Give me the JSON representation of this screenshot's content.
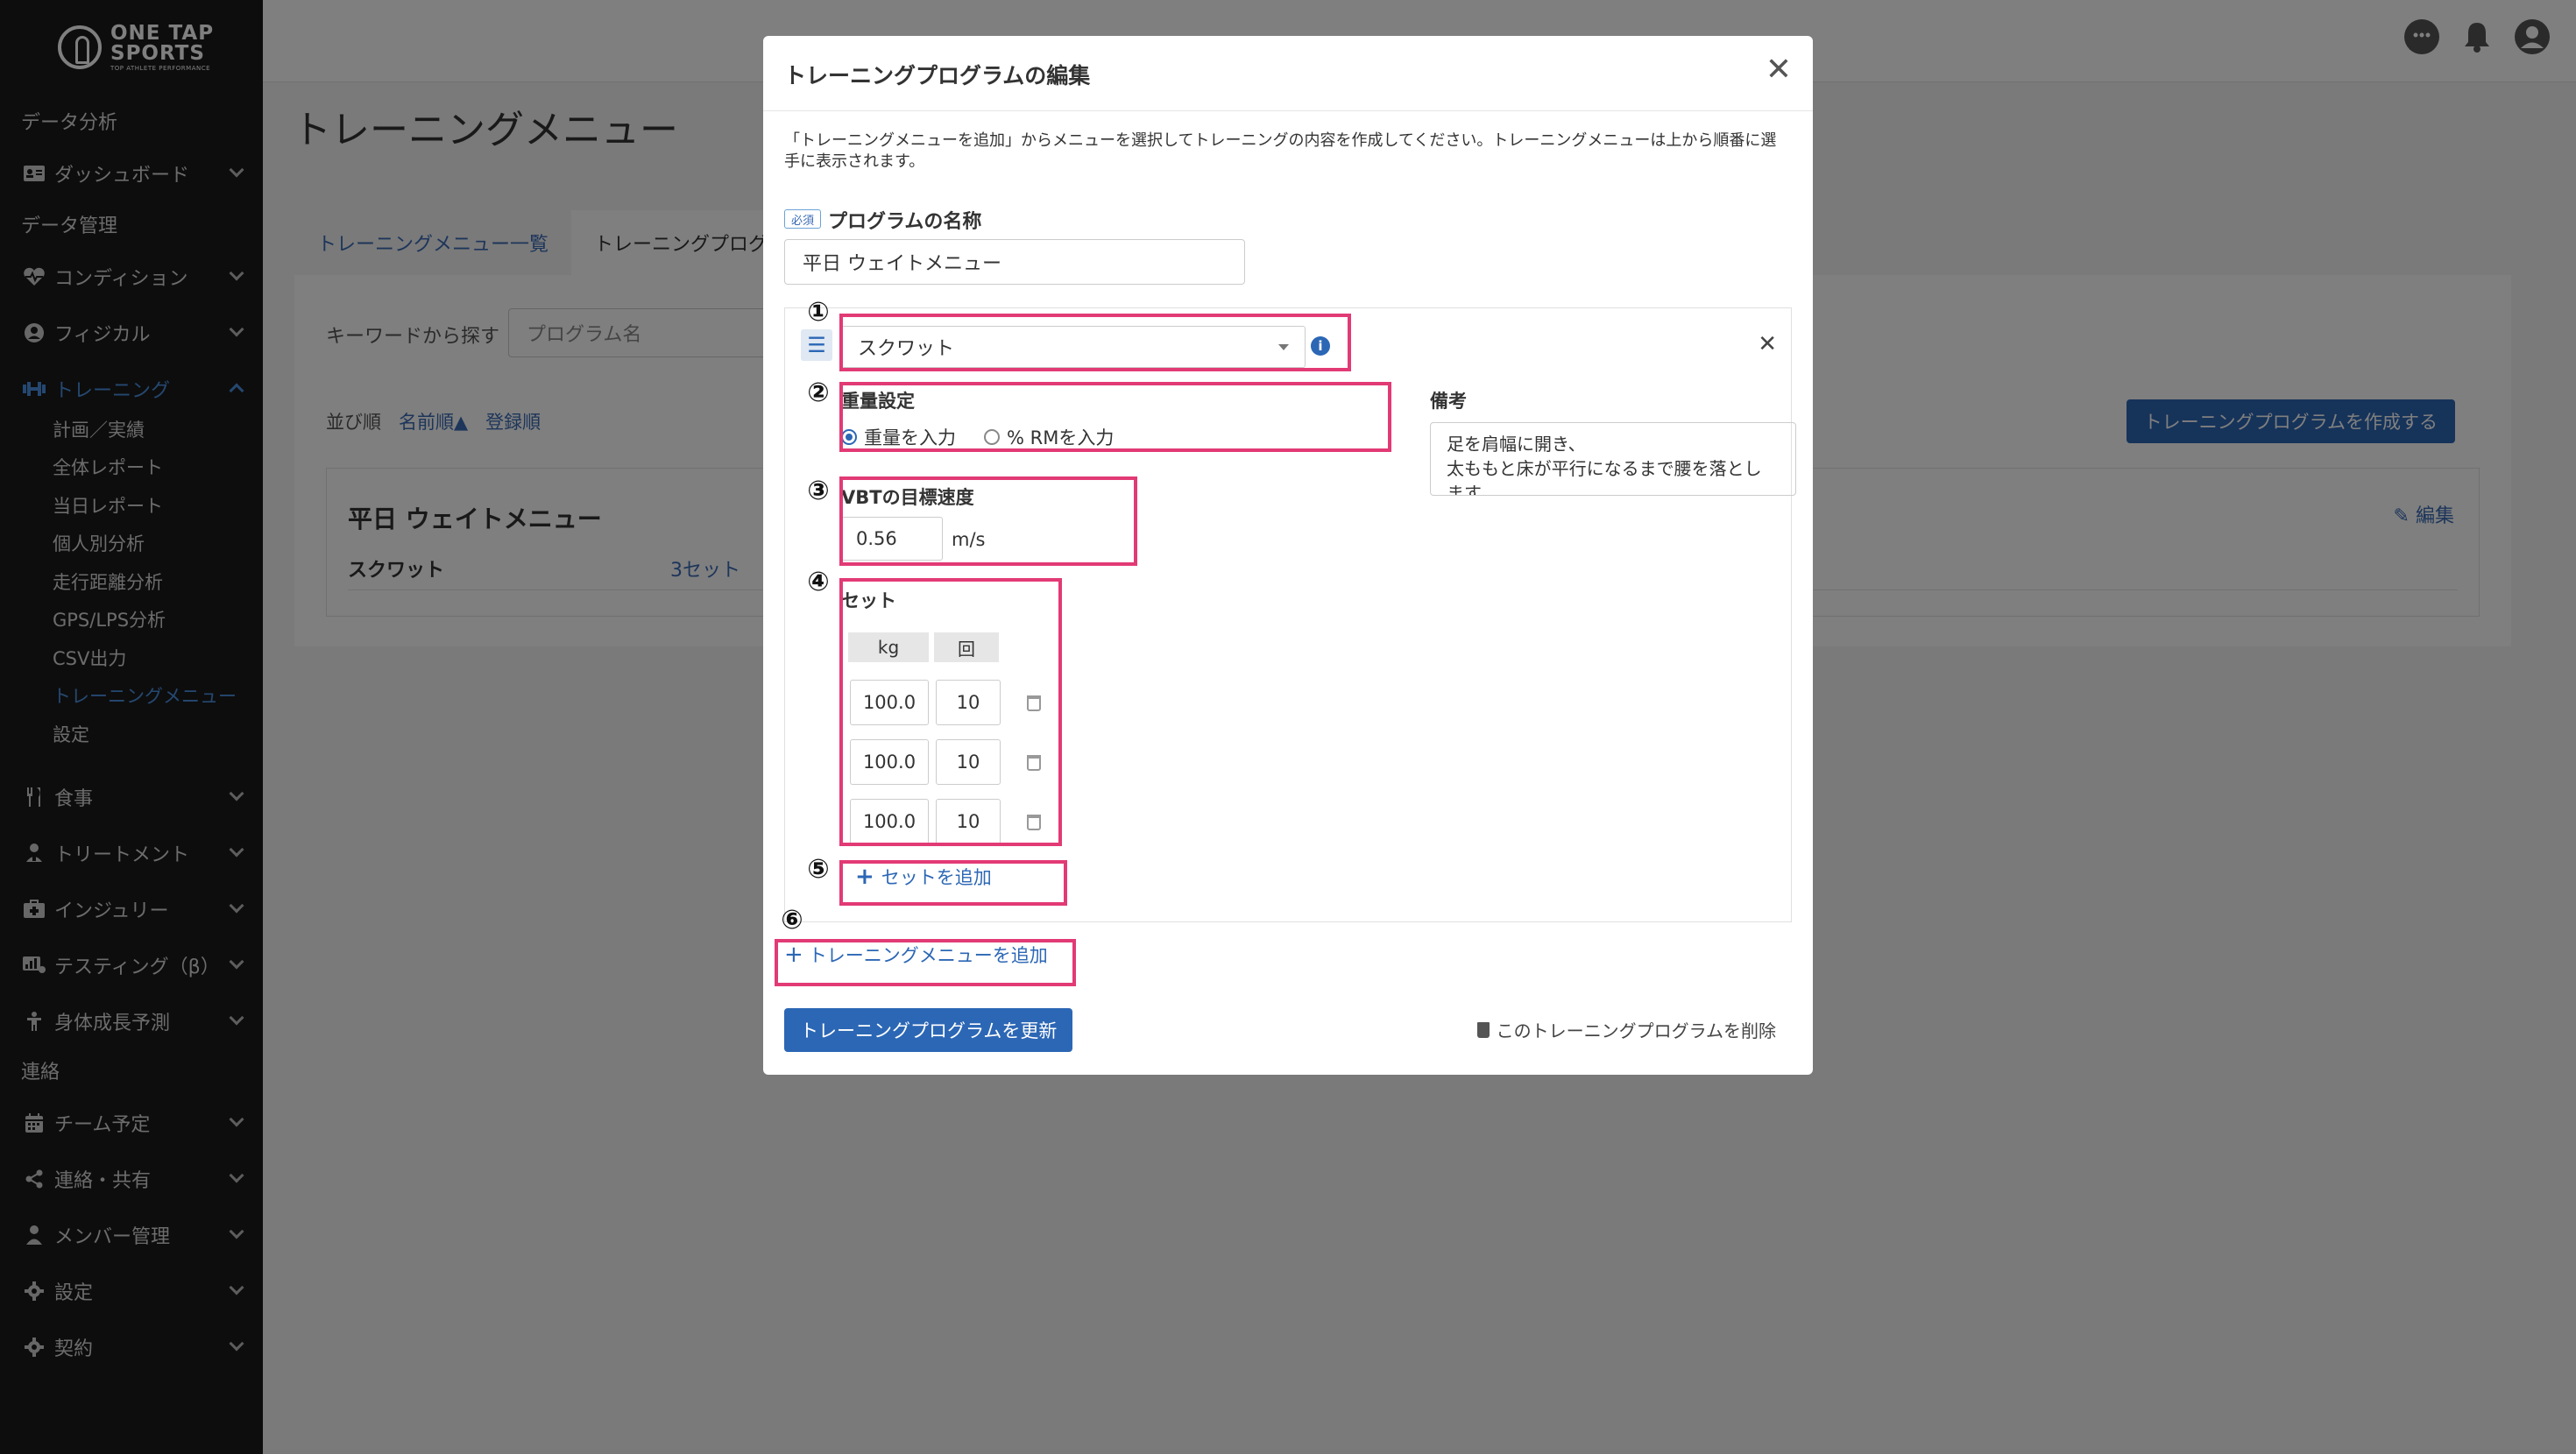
{
  "sidebar": {
    "logo": {
      "line1": "ONE TAP",
      "line2": "SPORTS",
      "tagline": "TOP ATHLETE PERFORMANCE"
    },
    "items": [
      {
        "label": "データ分析",
        "icon": "",
        "type": "section"
      },
      {
        "label": "ダッシュボード",
        "icon": "id-card-icon",
        "type": "menu"
      },
      {
        "label": "データ管理",
        "icon": "",
        "type": "section"
      },
      {
        "label": "コンディション",
        "icon": "heartbeat-icon",
        "type": "menu"
      },
      {
        "label": "フィジカル",
        "icon": "user-circle-icon",
        "type": "menu"
      },
      {
        "label": "トレーニング",
        "icon": "dumbbell-icon",
        "type": "menu-active"
      },
      {
        "label": "食事",
        "icon": "utensils-icon",
        "type": "menu"
      },
      {
        "label": "トリートメント",
        "icon": "treatment-icon",
        "type": "menu"
      },
      {
        "label": "インジュリー",
        "icon": "first-aid-icon",
        "type": "menu"
      },
      {
        "label": "テスティング（β）",
        "icon": "testing-icon",
        "type": "menu"
      },
      {
        "label": "身体成長予測",
        "icon": "child-icon",
        "type": "menu"
      },
      {
        "label": "連絡",
        "icon": "",
        "type": "section"
      },
      {
        "label": "チーム予定",
        "icon": "calendar-icon",
        "type": "menu"
      },
      {
        "label": "連絡・共有",
        "icon": "share-icon",
        "type": "menu"
      },
      {
        "label": "メンバー管理",
        "icon": "user-icon",
        "type": "menu"
      },
      {
        "label": "設定",
        "icon": "gear-icon",
        "type": "menu"
      },
      {
        "label": "契約",
        "icon": "gear-icon",
        "type": "menu"
      }
    ],
    "training_sub": [
      "計画／実績",
      "全体レポート",
      "当日レポート",
      "個人別分析",
      "走行距離分析",
      "GPS/LPS分析",
      "CSV出力",
      "トレーニングメニュー",
      "設定"
    ]
  },
  "page": {
    "title": "トレーニングメニュー",
    "tabs": [
      "トレーニングメニュー一覧",
      "トレーニングプログラム"
    ],
    "search_label": "キーワードから探す",
    "search_placeholder": "プログラム名",
    "sort_label": "並び順",
    "sort_name": "名前順▲",
    "sort_registered": "登録順",
    "create_button": "トレーニングプログラムを作成する",
    "program": {
      "name": "平日 ウェイトメニュー",
      "edit": "編集",
      "exercise": "スクワット",
      "sets": "3セット"
    }
  },
  "modal": {
    "title": "トレーニングプログラムの編集",
    "intro": "「トレーニングメニューを追加」からメニューを選択してトレーニングの内容を作成してください。トレーニングメニューは上から順番に選手に表示されます。",
    "required_badge": "必須",
    "program_name_label": "プログラムの名称",
    "program_name_value": "平日 ウェイトメニュー",
    "exercise_value": "スクワット",
    "weight_setting_label": "重量設定",
    "weight_options": [
      "重量を入力",
      "% RMを入力"
    ],
    "memo_label": "備考",
    "memo_lines": [
      "足を肩幅に開き、",
      "太ももと床が平行になるまで腰を落とし",
      "ます。"
    ],
    "vbt_label": "VBTの目標速度",
    "vbt_value": "0.56",
    "vbt_unit": "m/s",
    "sets_label": "セット",
    "set_headers": [
      "kg",
      "回"
    ],
    "sets": [
      {
        "kg": "100.0",
        "reps": "10"
      },
      {
        "kg": "100.0",
        "reps": "10"
      },
      {
        "kg": "100.0",
        "reps": "10"
      }
    ],
    "add_set": "セットを追加",
    "add_menu": "トレーニングメニューを追加",
    "update_button": "トレーニングプログラムを更新",
    "delete_link": "このトレーニングプログラムを削除"
  },
  "annotations": [
    "①",
    "②",
    "③",
    "④",
    "⑤",
    "⑥"
  ],
  "colors": {
    "accent": "#2c67b5",
    "annotation": "#e23a75",
    "sidebar_bg": "#1b1b1b",
    "active_nav": "#4a90e2"
  }
}
